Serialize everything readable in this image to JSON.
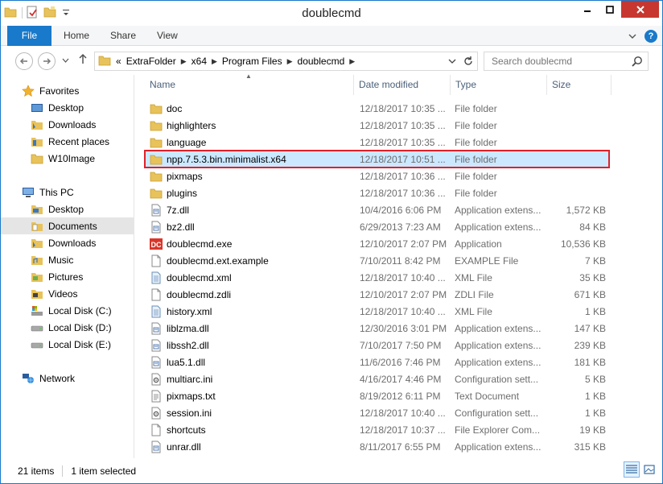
{
  "window": {
    "title": "doublecmd"
  },
  "quick_access": {
    "icons": [
      "folder-icon",
      "properties-icon",
      "new-folder-icon",
      "dropdown-icon"
    ]
  },
  "ribbon": {
    "tabs": [
      {
        "label": "File",
        "active": true
      },
      {
        "label": "Home"
      },
      {
        "label": "Share"
      },
      {
        "label": "View"
      }
    ]
  },
  "address": {
    "overflow": "«",
    "crumbs": [
      "ExtraFolder",
      "x64",
      "Program Files",
      "doublecmd"
    ]
  },
  "search": {
    "placeholder": "Search doublecmd"
  },
  "nav": {
    "favorites_label": "Favorites",
    "favorites": [
      {
        "label": "Desktop",
        "icon": "desktop-icon"
      },
      {
        "label": "Downloads",
        "icon": "downloads-icon"
      },
      {
        "label": "Recent places",
        "icon": "recent-places-icon"
      },
      {
        "label": "W10Image",
        "icon": "folder-icon"
      }
    ],
    "thispc_label": "This PC",
    "thispc": [
      {
        "label": "Desktop",
        "icon": "desktop-icon"
      },
      {
        "label": "Documents",
        "icon": "documents-icon",
        "selected": true
      },
      {
        "label": "Downloads",
        "icon": "downloads-icon"
      },
      {
        "label": "Music",
        "icon": "music-icon"
      },
      {
        "label": "Pictures",
        "icon": "pictures-icon"
      },
      {
        "label": "Videos",
        "icon": "videos-icon"
      },
      {
        "label": "Local Disk (C:)",
        "icon": "system-drive-icon"
      },
      {
        "label": "Local Disk (D:)",
        "icon": "drive-icon"
      },
      {
        "label": "Local Disk (E:)",
        "icon": "drive-icon"
      }
    ],
    "network_label": "Network"
  },
  "columns": {
    "name": "Name",
    "date": "Date modified",
    "type": "Type",
    "size": "Size"
  },
  "files": [
    {
      "name": "doc",
      "date": "12/18/2017 10:35 ...",
      "type": "File folder",
      "size": "",
      "icon": "folder-icon"
    },
    {
      "name": "highlighters",
      "date": "12/18/2017 10:35 ...",
      "type": "File folder",
      "size": "",
      "icon": "folder-icon"
    },
    {
      "name": "language",
      "date": "12/18/2017 10:35 ...",
      "type": "File folder",
      "size": "",
      "icon": "folder-icon"
    },
    {
      "name": "npp.7.5.3.bin.minimalist.x64",
      "date": "12/18/2017 10:51 ...",
      "type": "File folder",
      "size": "",
      "icon": "folder-icon",
      "selected": true
    },
    {
      "name": "pixmaps",
      "date": "12/18/2017 10:36 ...",
      "type": "File folder",
      "size": "",
      "icon": "folder-icon"
    },
    {
      "name": "plugins",
      "date": "12/18/2017 10:36 ...",
      "type": "File folder",
      "size": "",
      "icon": "folder-icon"
    },
    {
      "name": "7z.dll",
      "date": "10/4/2016 6:06 PM",
      "type": "Application extens...",
      "size": "1,572 KB",
      "icon": "dll-icon"
    },
    {
      "name": "bz2.dll",
      "date": "6/29/2013 7:23 AM",
      "type": "Application extens...",
      "size": "84 KB",
      "icon": "dll-icon"
    },
    {
      "name": "doublecmd.exe",
      "date": "12/10/2017 2:07 PM",
      "type": "Application",
      "size": "10,536 KB",
      "icon": "doublecmd-app-icon"
    },
    {
      "name": "doublecmd.ext.example",
      "date": "7/10/2011 8:42 PM",
      "type": "EXAMPLE File",
      "size": "7 KB",
      "icon": "file-icon"
    },
    {
      "name": "doublecmd.xml",
      "date": "12/18/2017 10:40 ...",
      "type": "XML File",
      "size": "35 KB",
      "icon": "xml-icon"
    },
    {
      "name": "doublecmd.zdli",
      "date": "12/10/2017 2:07 PM",
      "type": "ZDLI File",
      "size": "671 KB",
      "icon": "file-icon"
    },
    {
      "name": "history.xml",
      "date": "12/18/2017 10:40 ...",
      "type": "XML File",
      "size": "1 KB",
      "icon": "xml-icon"
    },
    {
      "name": "liblzma.dll",
      "date": "12/30/2016 3:01 PM",
      "type": "Application extens...",
      "size": "147 KB",
      "icon": "dll-icon"
    },
    {
      "name": "libssh2.dll",
      "date": "7/10/2017 7:50 PM",
      "type": "Application extens...",
      "size": "239 KB",
      "icon": "dll-icon"
    },
    {
      "name": "lua5.1.dll",
      "date": "11/6/2016 7:46 PM",
      "type": "Application extens...",
      "size": "181 KB",
      "icon": "dll-icon"
    },
    {
      "name": "multiarc.ini",
      "date": "4/16/2017 4:46 PM",
      "type": "Configuration sett...",
      "size": "5 KB",
      "icon": "ini-icon"
    },
    {
      "name": "pixmaps.txt",
      "date": "8/19/2012 6:11 PM",
      "type": "Text Document",
      "size": "1 KB",
      "icon": "txt-icon"
    },
    {
      "name": "session.ini",
      "date": "12/18/2017 10:40 ...",
      "type": "Configuration sett...",
      "size": "1 KB",
      "icon": "ini-icon"
    },
    {
      "name": "shortcuts",
      "date": "12/18/2017 10:37 ...",
      "type": "File Explorer Com...",
      "size": "19 KB",
      "icon": "file-icon"
    },
    {
      "name": "unrar.dll",
      "date": "8/11/2017 6:55 PM",
      "type": "Application extens...",
      "size": "315 KB",
      "icon": "dll-icon"
    }
  ],
  "status": {
    "items": "21 items",
    "selected": "1 item selected"
  },
  "colors": {
    "accent": "#1979ca",
    "selection": "#cce8ff",
    "highlight_border": "#e0202a",
    "close": "#c7372f"
  }
}
